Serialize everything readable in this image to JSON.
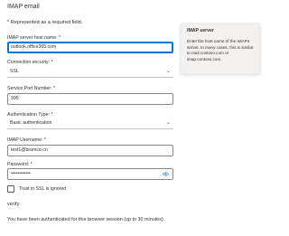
{
  "page": {
    "title": "IMAP email",
    "required_note": "* Represented as a required field."
  },
  "fields": {
    "server_host": {
      "label": "IMAP server host name: *",
      "value": "outlook.office365.com"
    },
    "connection_security": {
      "label": "Connection security: *",
      "value": "SSL"
    },
    "port": {
      "label": "Service Port Number: *",
      "value": "995"
    },
    "auth_type": {
      "label": "Authentication Type: *",
      "value": "Basic authentication"
    },
    "username": {
      "label": "IMAP Username: *",
      "value": "test1@bramco.cn"
    },
    "password": {
      "label": "Password: *",
      "value": "••••••••••••"
    }
  },
  "trust_ssl": {
    "label": "Trust in SSL is ignored",
    "checked": false
  },
  "verify_label": "verify",
  "auth_message": "You have been authenticated for this browser session (up to 30 minutes).",
  "tooltip": {
    "title": "IMAP server",
    "body": "Enter the host name of the IMAP4 server. In many cases, this is similar to mail.contoso.com or imap.contoso.com."
  },
  "icons": {
    "select_chevron": "chevron-down-icon",
    "password_reveal": "eye-icon"
  },
  "colors": {
    "accent": "#0078d4",
    "text": "#323130",
    "tooltip_bg": "#f3f2f1"
  }
}
